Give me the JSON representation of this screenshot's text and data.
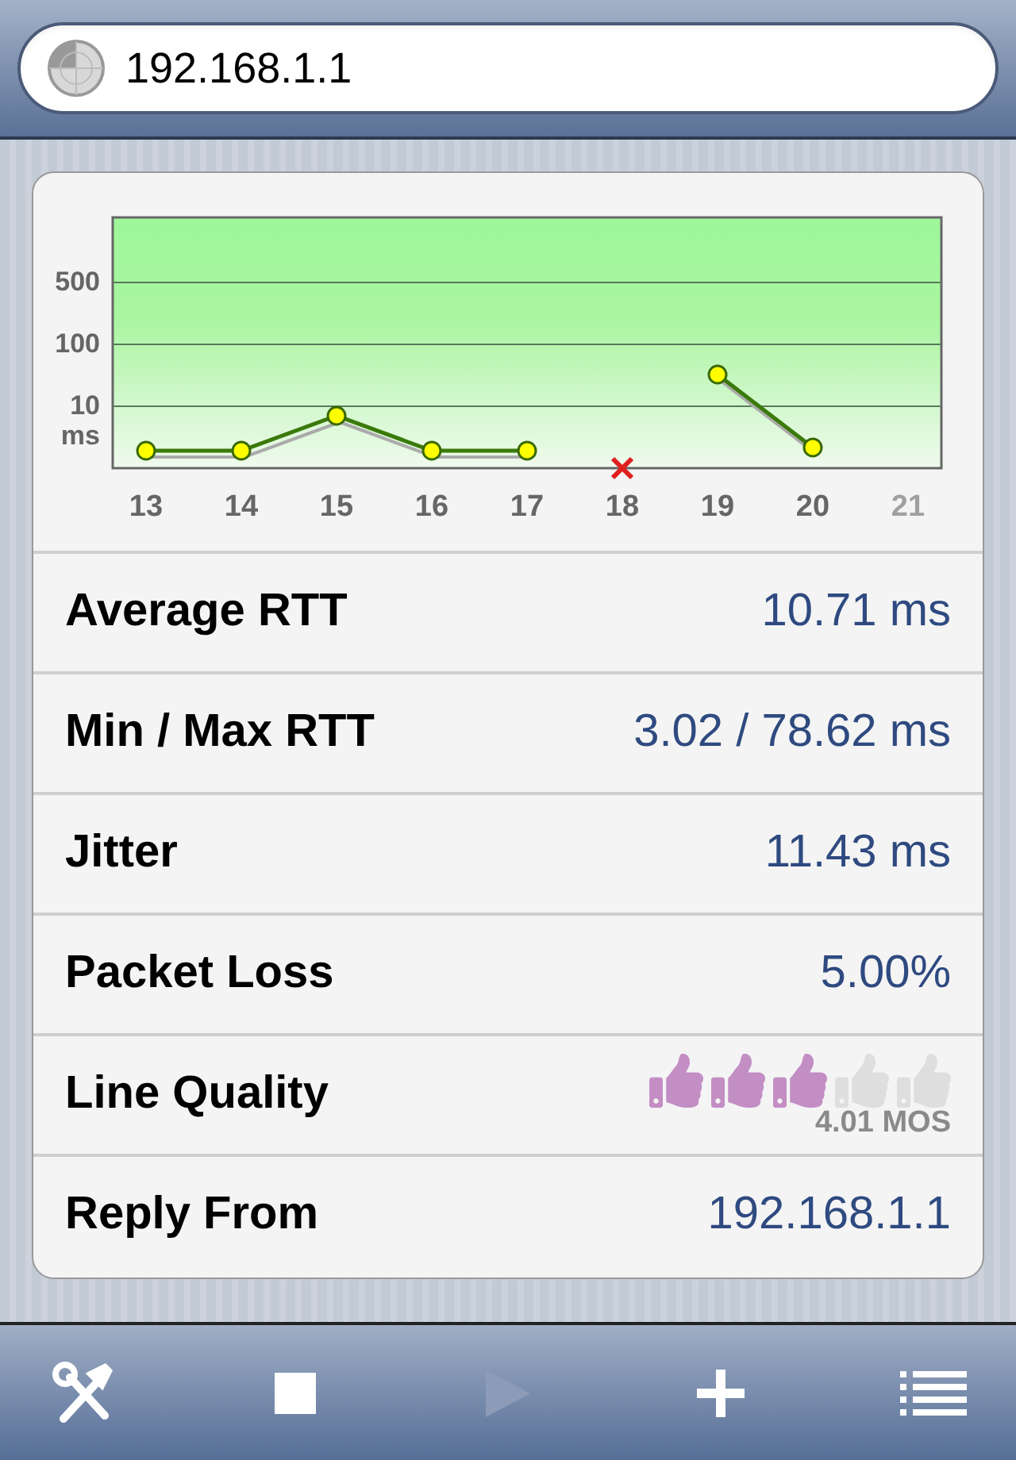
{
  "address_field": {
    "value": "192.168.1.1"
  },
  "chart": {
    "y_labels": [
      "500",
      "100",
      "10"
    ],
    "y_unit": "ms",
    "x_labels": [
      {
        "label": "13",
        "dimmed": false
      },
      {
        "label": "14",
        "dimmed": false
      },
      {
        "label": "15",
        "dimmed": false
      },
      {
        "label": "16",
        "dimmed": false
      },
      {
        "label": "17",
        "dimmed": false
      },
      {
        "label": "18",
        "dimmed": false
      },
      {
        "label": "19",
        "dimmed": false
      },
      {
        "label": "20",
        "dimmed": false
      },
      {
        "label": "21",
        "dimmed": true
      }
    ]
  },
  "stats": [
    {
      "kind": "text",
      "label": "Average RTT",
      "value": "10.71 ms"
    },
    {
      "kind": "text",
      "label": "Min / Max RTT",
      "value": "3.02 / 78.62 ms"
    },
    {
      "kind": "text",
      "label": "Jitter",
      "value": "11.43 ms"
    },
    {
      "kind": "text",
      "label": "Packet Loss",
      "value": "5.00%"
    },
    {
      "kind": "rating",
      "label": "Line Quality",
      "stars": 3,
      "value": "4.01 MOS"
    },
    {
      "kind": "text",
      "label": "Reply From",
      "value": "192.168.1.1"
    }
  ],
  "toolbar": [
    {
      "kind": "tools",
      "disabled": false
    },
    {
      "kind": "stop",
      "disabled": false
    },
    {
      "kind": "play",
      "disabled": true
    },
    {
      "kind": "add",
      "disabled": false
    },
    {
      "kind": "list",
      "disabled": false
    }
  ]
}
